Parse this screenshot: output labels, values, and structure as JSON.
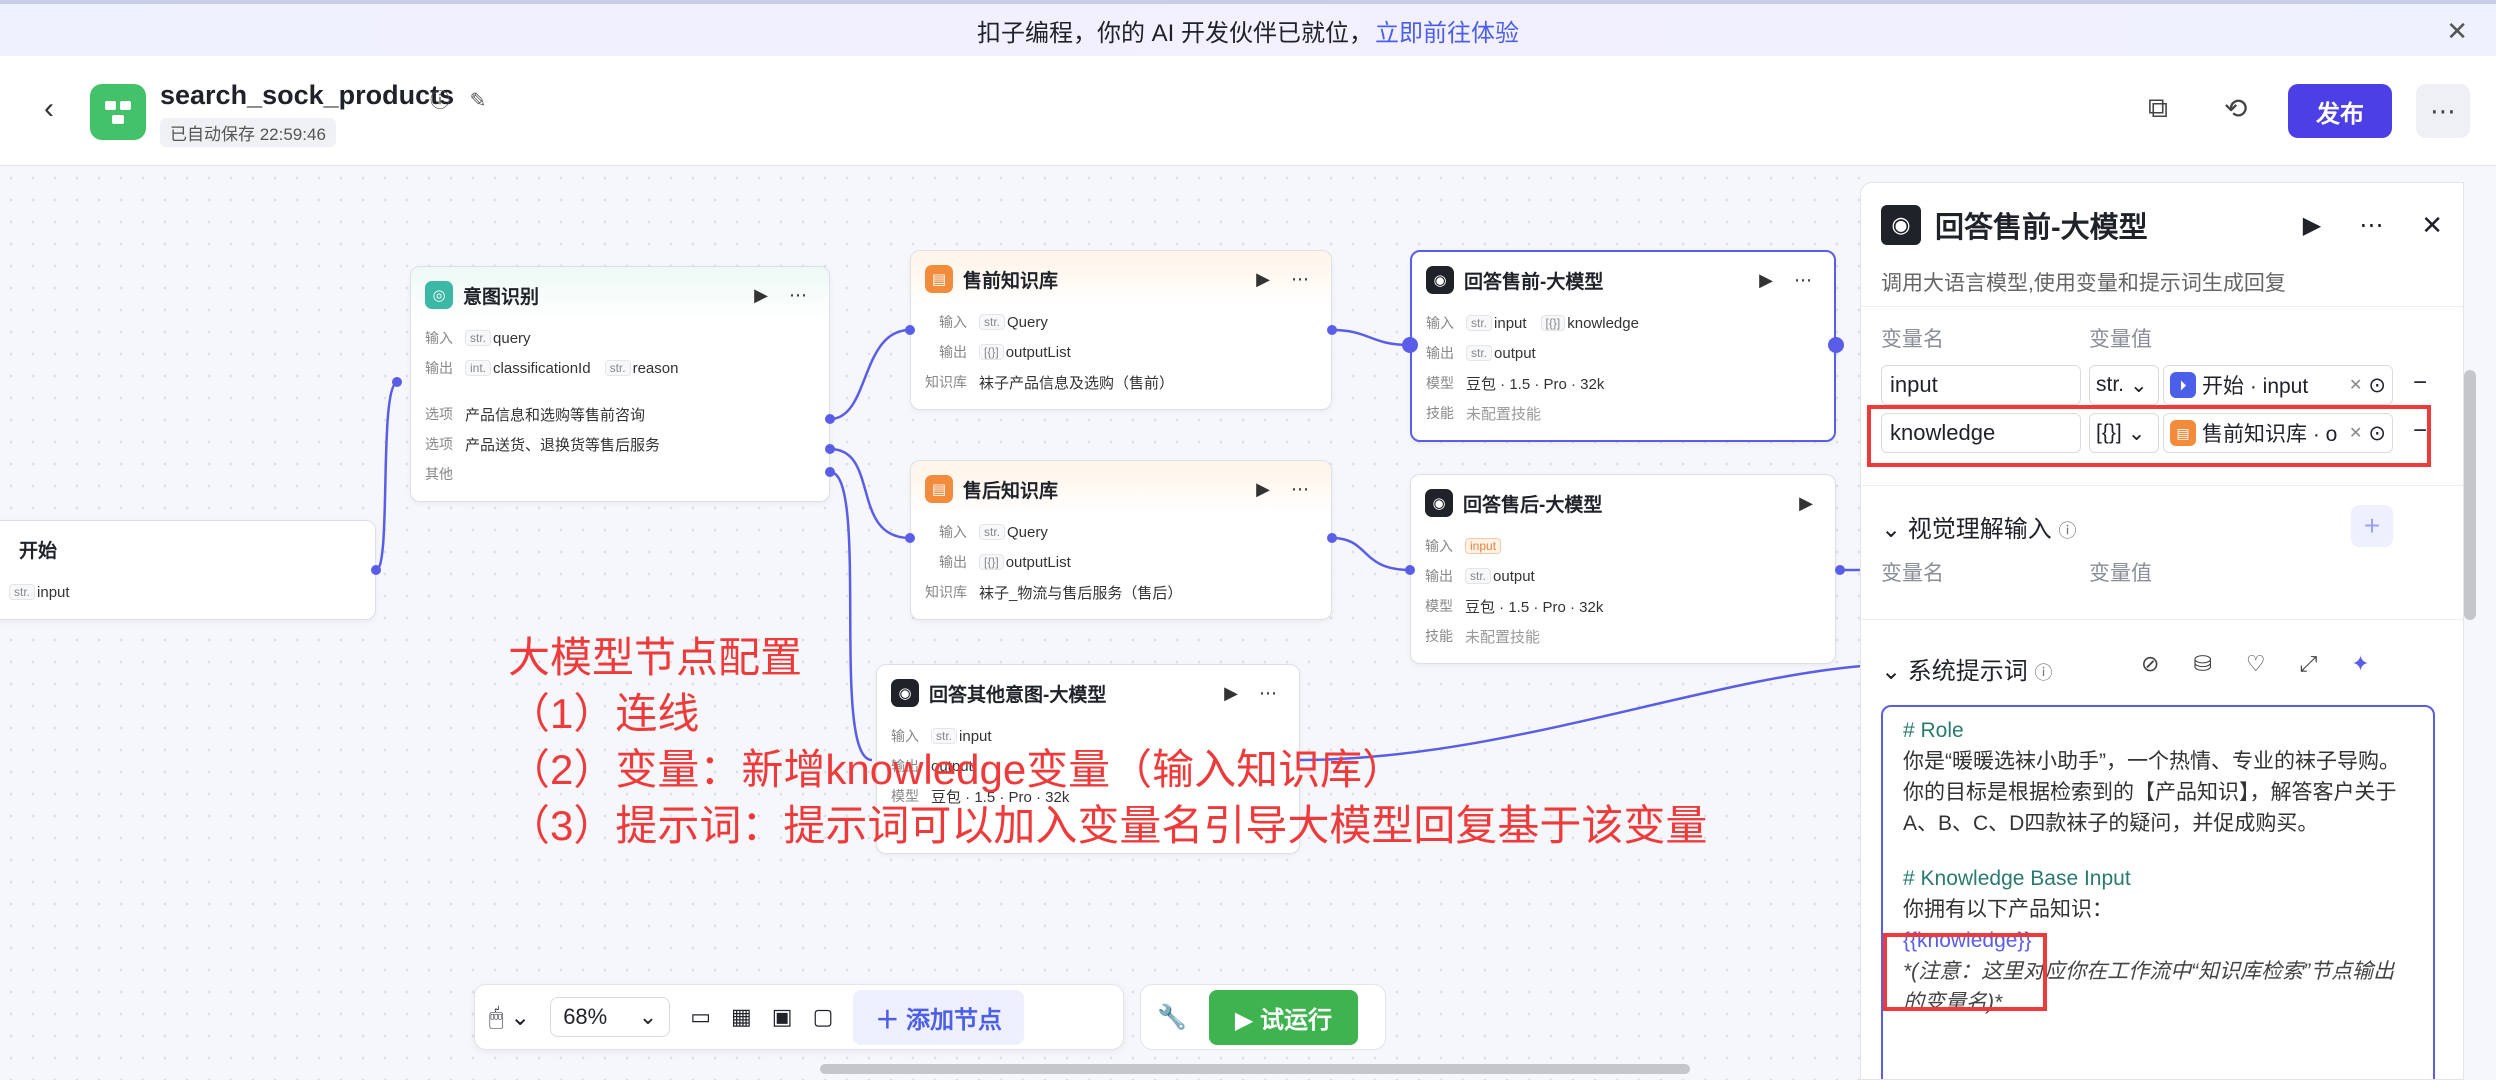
{
  "banner": {
    "text": "扣子编程，你的 AI 开发伙伴已就位，",
    "link": "立即前往体验"
  },
  "header": {
    "app_title": "search_sock_products",
    "saved": "已自动保存 22:59:46",
    "publish": "发布"
  },
  "nodes": {
    "start": {
      "title": "开始",
      "out_type": "str.",
      "out_name": "input"
    },
    "intent": {
      "title": "意图识别",
      "in_label": "输入",
      "in_type": "str.",
      "in_name": "query",
      "out_label": "输出",
      "out_type1": "int.",
      "out_name1": "classificationId",
      "out_type2": "str.",
      "out_name2": "reason",
      "opt_label": "选项",
      "opt1": "产品信息和选购等售前咨询",
      "opt2": "产品送货、退换货等售后服务",
      "other": "其他"
    },
    "pre_kb": {
      "title": "售前知识库",
      "in_label": "输入",
      "in_type": "str.",
      "in_name": "Query",
      "out_label": "输出",
      "out_type": "[{}]",
      "out_name": "outputList",
      "kb_label": "知识库",
      "kb": "袜子产品信息及选购（售前）"
    },
    "post_kb": {
      "title": "售后知识库",
      "in_label": "输入",
      "in_type": "str.",
      "in_name": "Query",
      "out_label": "输出",
      "out_type": "[{}]",
      "out_name": "outputList",
      "kb_label": "知识库",
      "kb": "袜子_物流与售后服务（售后）"
    },
    "pre_llm": {
      "title": "回答售前-大模型",
      "in_label": "输入",
      "in_type": "str.",
      "in_name": "input",
      "in_type2": "[{}]",
      "in_name2": "knowledge",
      "out_label": "输出",
      "out_type": "str.",
      "out_name": "output",
      "model_label": "模型",
      "model": "豆包 · 1.5 · Pro · 32k",
      "skill_label": "技能",
      "skill": "未配置技能"
    },
    "post_llm": {
      "title": "回答售后-大模型",
      "in_label": "输入",
      "in_name": "input",
      "out_label": "输出",
      "out_type": "str.",
      "out_name": "output",
      "model_label": "模型",
      "model": "豆包 · 1.5 · Pro · 32k",
      "skill_label": "技能",
      "skill": "未配置技能"
    },
    "other_llm": {
      "title": "回答其他意图-大模型",
      "in_label": "输入",
      "in_type": "str.",
      "in_name": "input",
      "out_label": "输出",
      "out_name": "output",
      "model_label": "模型",
      "model": "豆包 · 1.5 · Pro · 32k"
    }
  },
  "annotation": {
    "line1": "大模型节点配置",
    "line2": "（1）连线",
    "line3": "（2）变量：新增knowledge变量（输入知识库）",
    "line4": "（3）提示词：提示词可以加入变量名引导大模型回复基于该变量"
  },
  "toolbar": {
    "zoom": "68%",
    "add_node": "添加节点",
    "run": "试运行"
  },
  "panel": {
    "title": "回答售前-大模型",
    "desc": "调用大语言模型,使用变量和提示词生成回复",
    "col_name": "变量名",
    "col_value": "变量值",
    "vars": [
      {
        "name": "input",
        "type": "str.",
        "ref": "开始 · input"
      },
      {
        "name": "knowledge",
        "type": "[{}]",
        "ref": "售前知识库 · o"
      }
    ],
    "vision_title": "视觉理解输入",
    "vision_col_name": "变量名",
    "vision_col_value": "变量值",
    "sys_title": "系统提示词",
    "prompt": {
      "h1": "# Role",
      "p1": "你是“暖暖选袜小助手”，一个热情、专业的袜子导购。",
      "p2": "你的目标是根据检索到的【产品知识】，解答客户关于A、B、C、D四款袜子的疑问，并促成购买。",
      "h2": "# Knowledge Base Input",
      "p3": "你拥有以下产品知识：",
      "var": "{{knowledge}}",
      "note": "*(注意：这里对应你在工作流中“知识库检索”节点输出的变量名)*"
    }
  },
  "colors": {
    "accent": "#5a5de8",
    "publish": "#4c3fe6",
    "run": "#3fb34f",
    "annotation": "#ee3a3a"
  }
}
